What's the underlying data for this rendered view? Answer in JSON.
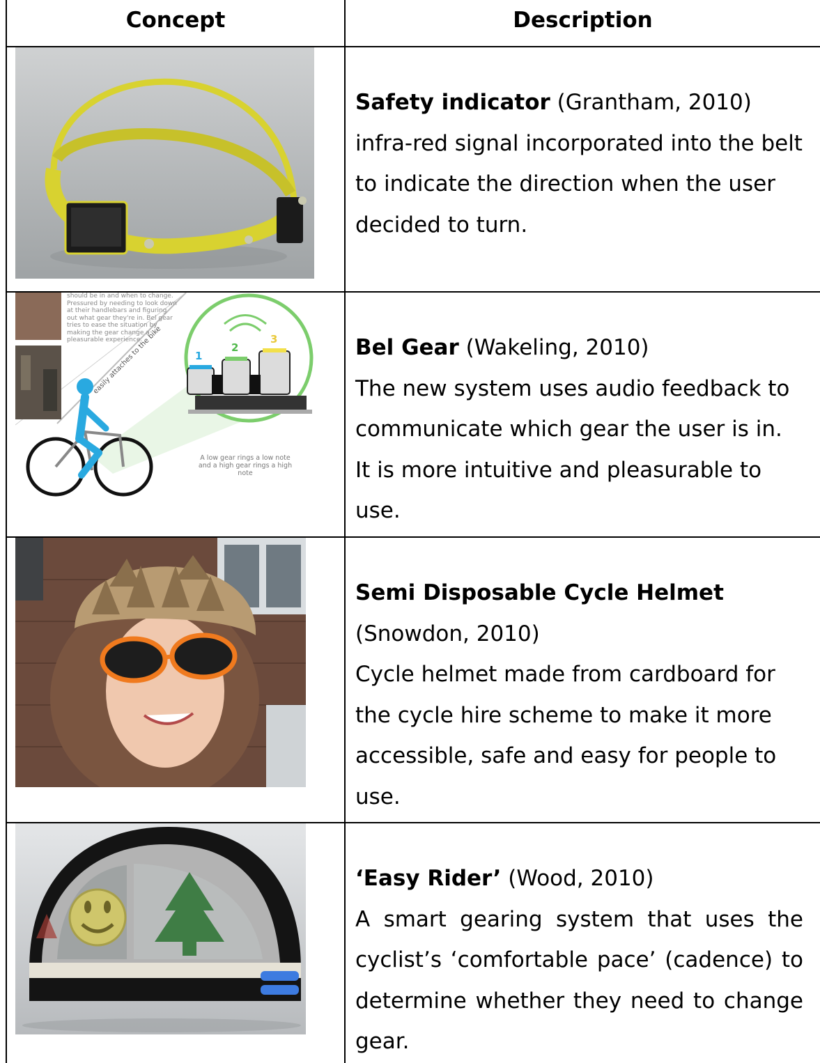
{
  "headers": {
    "concept": "Concept",
    "description": "Description"
  },
  "rows": [
    {
      "title": "Safety indicator",
      "citation": " (Grantham, 2010)",
      "body": "infra-red signal incorporated into the belt to indicate the direction when the user decided to turn.",
      "image": "yellow-belt-product-render"
    },
    {
      "title": "Bel Gear",
      "citation": " (Wakeling, 2010)",
      "body": "The new system uses audio feedback to communicate which gear the user is in. It is more intuitive and pleasurable to use.",
      "image": "bicycle-gear-diagram",
      "image_text": {
        "panel": "should be in and when to change. Pressured by needing to look down at their handlebars and figuring out what gear they're in. Bel gear tries to ease the situation by making the gear change a pleasurable experience.",
        "diagonal": "easily attaches to the bike",
        "caption": "A low gear rings a low note and a high gear rings a high note",
        "gear_1": "1",
        "gear_2": "2",
        "gear_3": "3"
      }
    },
    {
      "title": "Semi Disposable Cycle Helmet",
      "citation": "(Snowdon, 2010)",
      "body": "Cycle helmet made from cardboard for the cycle hire scheme to make it more accessible, safe and easy for people to use.",
      "image": "cardboard-helmet-photo"
    },
    {
      "title": "‘Easy Rider’",
      "citation": " (Wood, 2010)",
      "body": "A smart gearing system that uses the cyclist’s ‘comfortable pace’ (cadence) to determine whether they need to change gear.",
      "image": "smiley-gear-device-render"
    }
  ],
  "colors": {
    "border": "#000000",
    "belt": "#d8d230",
    "bike_blue": "#29a9e0",
    "circle_green": "#7ccd6c"
  }
}
